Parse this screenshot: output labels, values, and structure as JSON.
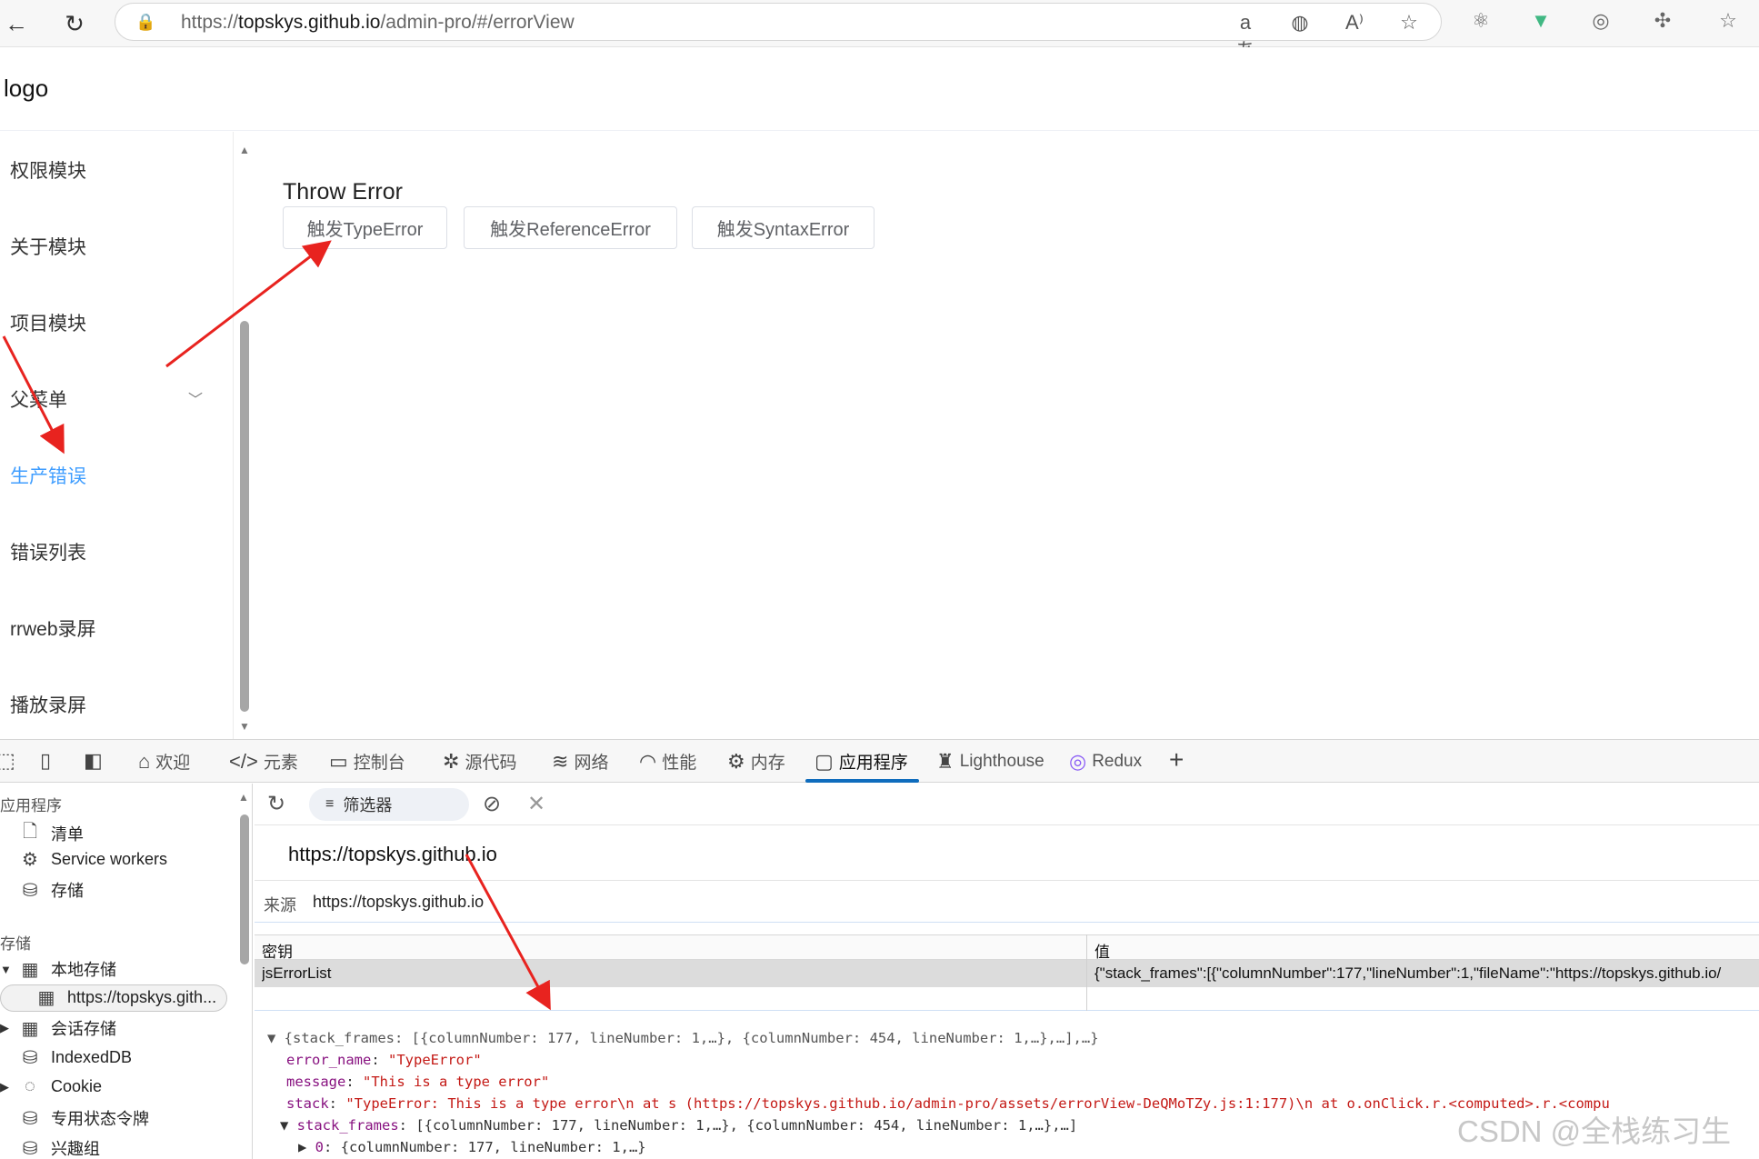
{
  "browser": {
    "url_prefix": "https://",
    "url_host": "topskys.github.io",
    "url_path": "/admin-pro/#/errorView",
    "icons": [
      "back-icon",
      "refresh-icon",
      "lock-icon",
      "translate-icon",
      "edge-icon",
      "read-aloud-icon",
      "favorite-star-icon"
    ]
  },
  "header": {
    "logo": "logo"
  },
  "sidebar": {
    "items": [
      {
        "label": "权限模块"
      },
      {
        "label": "关于模块"
      },
      {
        "label": "项目模块"
      },
      {
        "label": "父菜单"
      },
      {
        "label": "生产错误"
      },
      {
        "label": "错误列表"
      },
      {
        "label": "rrweb录屏"
      },
      {
        "label": "播放录屏"
      }
    ],
    "active": "生产错误"
  },
  "main": {
    "title": "Throw Error",
    "buttons": [
      {
        "label": "触发TypeError"
      },
      {
        "label": "触发ReferenceError"
      },
      {
        "label": "触发SyntaxError"
      }
    ]
  },
  "devtools": {
    "tabs": [
      {
        "label": "欢迎"
      },
      {
        "label": "元素"
      },
      {
        "label": "控制台"
      },
      {
        "label": "源代码"
      },
      {
        "label": "网络"
      },
      {
        "label": "性能"
      },
      {
        "label": "内存"
      },
      {
        "label": "应用程序"
      },
      {
        "label": "Lighthouse"
      },
      {
        "label": "Redux"
      }
    ],
    "active_tab": "应用程序",
    "sidebar": {
      "section_app": "应用程序",
      "app_items": [
        "清单",
        "Service workers",
        "存储"
      ],
      "section_storage": "存储",
      "storage_items": [
        "本地存储",
        "https://topskys.gith...",
        "会话存储",
        "IndexedDB",
        "Cookie",
        "专用状态令牌",
        "兴趣组"
      ]
    },
    "toolbar": {
      "filter": "筛选器"
    },
    "origin": "https://topskys.github.io",
    "source_label": "来源",
    "source_value": "https://topskys.github.io",
    "table": {
      "headers": [
        "密钥",
        "值"
      ],
      "row_key": "jsErrorList",
      "row_value": "{\"stack_frames\":[{\"columnNumber\":177,\"lineNumber\":1,\"fileName\":\"https://topskys.github.io/"
    },
    "json_lines": {
      "l1": "{stack_frames: [{columnNumber: 177, lineNumber: 1,…}, {columnNumber: 454, lineNumber: 1,…},…],…}",
      "l2_key": "error_name",
      "l2_val": "\"TypeError\"",
      "l3_key": "message",
      "l3_val": "\"This is a type error\"",
      "l4_key": "stack",
      "l4_val": "\"TypeError: This is a type error\\n    at s (https://topskys.github.io/admin-pro/assets/errorView-DeQMoTZy.js:1:177)\\n    at o.onClick.r.<computed>.r.<compu",
      "l5_key": "stack_frames",
      "l5_val": "[{columnNumber: 177, lineNumber: 1,…}, {columnNumber: 454, lineNumber: 1,…},…]",
      "l6_key": "0",
      "l6_val": "{columnNumber: 177, lineNumber: 1,…}"
    }
  },
  "watermark": "CSDN @全栈练习生",
  "colors": {
    "accent": "#409eff",
    "annotation_arrow": "#e8231f",
    "devtools_active": "#0f6cbd"
  }
}
